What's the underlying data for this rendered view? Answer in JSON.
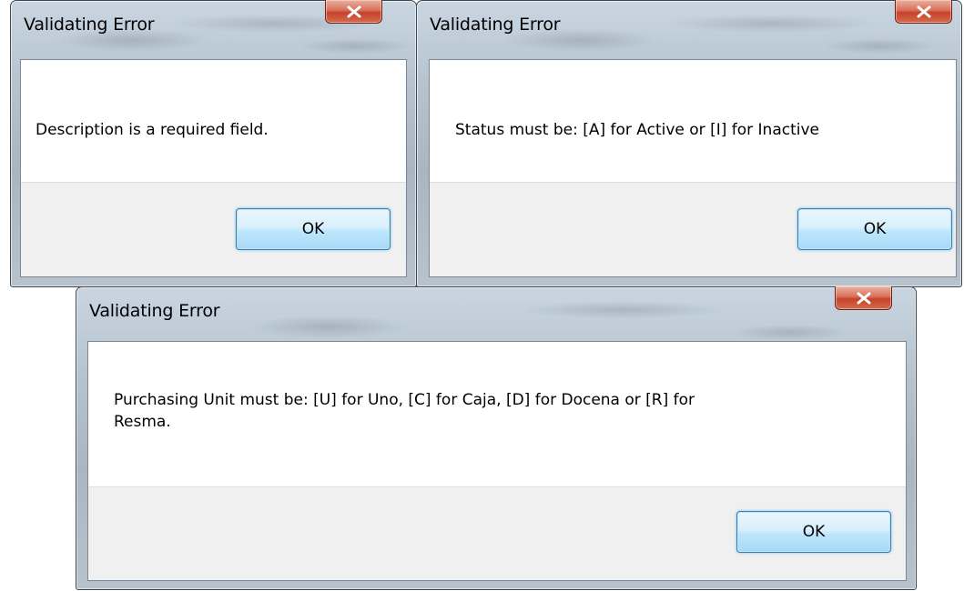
{
  "dialogs": [
    {
      "title": "Validating Error",
      "message": "Description is a required field.",
      "ok_label": "OK",
      "close_icon": "close-x-icon"
    },
    {
      "title": "Validating Error",
      "message": "Status must be: [A] for Active or [I] for Inactive",
      "ok_label": "OK",
      "close_icon": "close-x-icon"
    },
    {
      "title": "Validating Error",
      "message": "Purchasing Unit must be: [U] for Uno, [C] for Caja, [D] for Docena or [R] for Resma.",
      "ok_label": "OK",
      "close_icon": "close-x-icon"
    }
  ],
  "colors": {
    "close_button": "#c5432a",
    "ok_button_border": "#3c7fb1",
    "footer_bg": "#f0f0f0"
  }
}
